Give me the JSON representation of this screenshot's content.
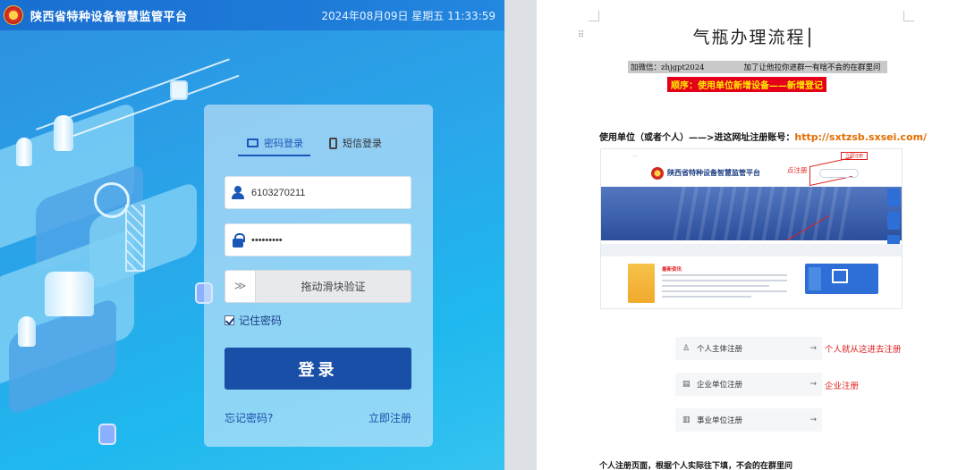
{
  "login_page": {
    "site_title": "陕西省特种设备智慧监管平台",
    "datetime": "2024年08月09日 星期五 11:33:59",
    "tabs": [
      {
        "label": "密码登录",
        "active": true
      },
      {
        "label": "短信登录",
        "active": false
      }
    ],
    "username_value": "6103270211",
    "password_value": "•••••••••",
    "slider_label": "拖动滑块验证",
    "slider_handle": "≫",
    "remember_label": "记住密码",
    "remember_checked": true,
    "login_button": "登录",
    "forgot_link": "忘记密码?",
    "register_link": "立即注册",
    "colors": {
      "topbar": "#1a6fd0",
      "primary_button": "#1a4fa8",
      "background": "#2aa6ea"
    }
  },
  "document": {
    "title": "气瓶办理流程",
    "wechat_left": "加微信：zhjgpt2024",
    "wechat_right": "加了让他拉你进群一有啥不会的在群里问",
    "order_line": "顺序：使用单位新增设备——新增登记",
    "step_text": "使用单位（或者个人）——>进这网址注册账号：",
    "step_url": "http://sxtzsb.sxsei.com/",
    "embedded_screenshot": {
      "site_title": "陕西省特种设备智慧监管平台",
      "annotation": "点注册",
      "register_tag": "立即注册",
      "news_title": "最新资讯"
    },
    "registration_items": [
      {
        "label": "个人主体注册",
        "icon": "person-icon",
        "note": "个人就从这进去注册"
      },
      {
        "label": "企业单位注册",
        "icon": "building-icon",
        "note": "企业注册"
      },
      {
        "label": "事业单位注册",
        "icon": "institution-icon",
        "note": ""
      }
    ],
    "arrow": "→",
    "bottom_text": "个人注册页面，根据个人实际往下填，不会的在群里问",
    "colors": {
      "order_bg": "#e4001b",
      "order_text": "#ffec00",
      "url": "#e36d00",
      "note": "#e02020"
    }
  }
}
